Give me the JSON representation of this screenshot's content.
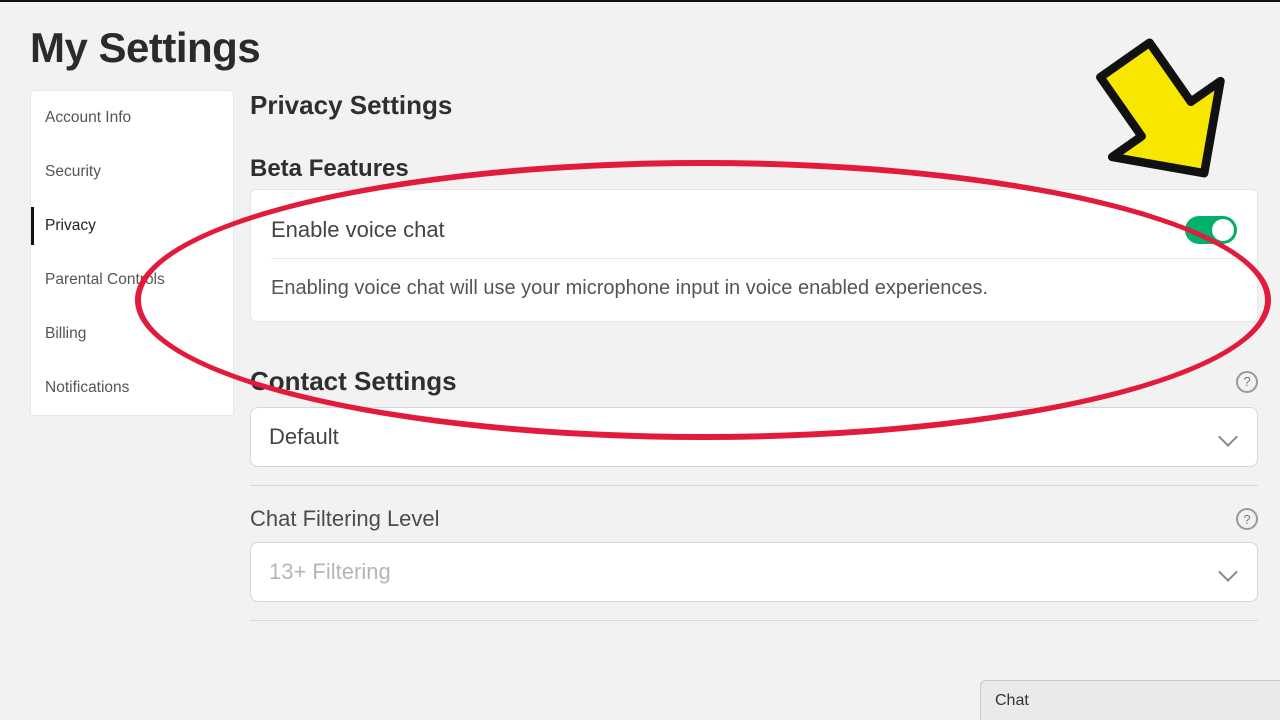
{
  "page": {
    "title": "My Settings"
  },
  "sidebar": {
    "items": [
      {
        "label": "Account Info"
      },
      {
        "label": "Security"
      },
      {
        "label": "Privacy",
        "active": true
      },
      {
        "label": "Parental Controls"
      },
      {
        "label": "Billing"
      },
      {
        "label": "Notifications"
      }
    ]
  },
  "privacy": {
    "heading": "Privacy Settings",
    "beta": {
      "heading": "Beta Features",
      "voice_chat": {
        "label": "Enable voice chat",
        "enabled": true,
        "description": "Enabling voice chat will use your microphone input in voice enabled experiences."
      }
    },
    "contact": {
      "heading": "Contact Settings",
      "select": {
        "value": "Default"
      }
    },
    "chat_filter": {
      "label": "Chat Filtering Level",
      "select": {
        "placeholder": "13+ Filtering"
      }
    }
  },
  "chat_dock": {
    "label": "Chat"
  },
  "annotations": {
    "ellipse_color": "#e21a3b",
    "arrow_fill": "#f7e600"
  }
}
